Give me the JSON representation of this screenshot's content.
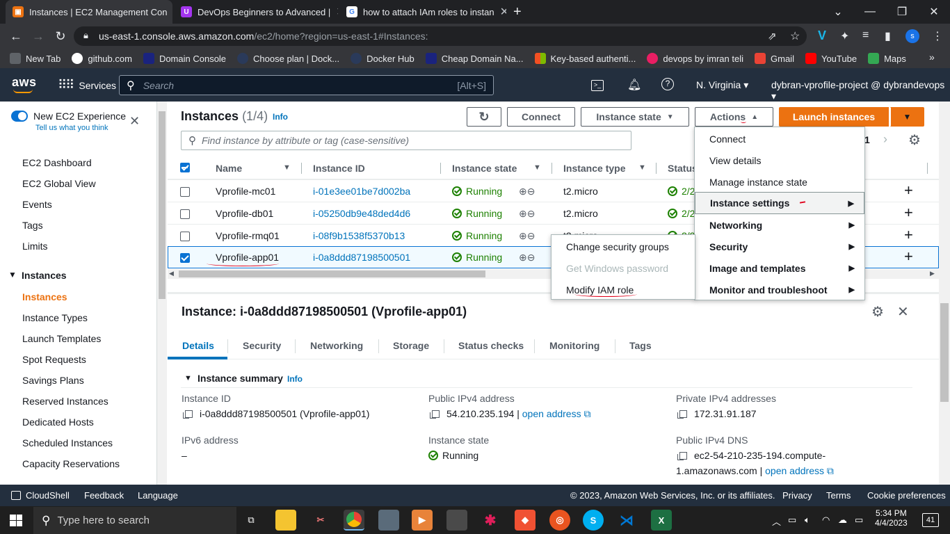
{
  "browser": {
    "tabs": [
      {
        "title": "Instances | EC2 Management Con",
        "active": true
      },
      {
        "title": "DevOps Beginners to Advanced |",
        "active": false
      },
      {
        "title": "how to attach IAm roles to instan",
        "active": false
      }
    ],
    "url_host": "us-east-1.console.aws.amazon.com",
    "url_path": "/ec2/home?region=us-east-1#Instances:",
    "bookmarks": [
      "New Tab",
      "github.com",
      "Domain Console",
      "Choose plan | Dock...",
      "Docker Hub",
      "Cheap Domain Na...",
      "Key-based authenti...",
      "devops by imran teli",
      "Gmail",
      "YouTube",
      "Maps"
    ]
  },
  "aws": {
    "logo": "aws",
    "services": "Services",
    "search_placeholder": "Search",
    "search_shortcut": "[Alt+S]",
    "region": "N. Virginia",
    "account": "dybran-vprofile-project @ dybrandevops"
  },
  "sidebar": {
    "new_experience": "New EC2 Experience",
    "tell_us": "Tell us what you think",
    "items": [
      "EC2 Dashboard",
      "EC2 Global View",
      "Events",
      "Tags",
      "Limits"
    ],
    "section": "Instances",
    "section_items": [
      "Instances",
      "Instance Types",
      "Launch Templates",
      "Spot Requests",
      "Savings Plans",
      "Reserved Instances",
      "Dedicated Hosts",
      "Scheduled Instances",
      "Capacity Reservations"
    ]
  },
  "instances": {
    "title": "Instances",
    "count": "(1/4)",
    "info": "Info",
    "connect": "Connect",
    "instance_state": "Instance state",
    "actions": "Actions",
    "launch": "Launch instances",
    "filter_placeholder": "Find instance by attribute or tag (case-sensitive)",
    "page": "1",
    "columns": [
      "Name",
      "Instance ID",
      "Instance state",
      "Instance type",
      "Status"
    ],
    "rows": [
      {
        "name": "Vprofile-mc01",
        "id": "i-01e3ee01be7d002ba",
        "state": "Running",
        "type": "t2.micro",
        "status": "2/2",
        "selected": false
      },
      {
        "name": "Vprofile-db01",
        "id": "i-05250db9e48ded4d6",
        "state": "Running",
        "type": "t2.micro",
        "status": "2/2",
        "selected": false
      },
      {
        "name": "Vprofile-rmq01",
        "id": "i-08f9b1538f5370b13",
        "state": "Running",
        "type": "t2.micro",
        "status": "2/2",
        "selected": false
      },
      {
        "name": "Vprofile-app01",
        "id": "i-0a8ddd87198500501",
        "state": "Running",
        "type": "",
        "status": "",
        "selected": true
      }
    ]
  },
  "actions_menu": {
    "items": [
      "Connect",
      "View details",
      "Manage instance state",
      "Instance settings",
      "Networking",
      "Security",
      "Image and templates",
      "Monitor and troubleshoot"
    ]
  },
  "security_submenu": {
    "items": [
      "Change security groups",
      "Get Windows password",
      "Modify IAM role"
    ]
  },
  "detail": {
    "title": "Instance: i-0a8ddd87198500501 (Vprofile-app01)",
    "tabs": [
      "Details",
      "Security",
      "Networking",
      "Storage",
      "Status checks",
      "Monitoring",
      "Tags"
    ],
    "summary": "Instance summary",
    "info": "Info",
    "instance_id_label": "Instance ID",
    "instance_id_value": "i-0a8ddd87198500501 (Vprofile-app01)",
    "public_ipv4_label": "Public IPv4 address",
    "public_ipv4_value": "54.210.235.194",
    "open_address": "open address",
    "private_ipv4_label": "Private IPv4 addresses",
    "private_ipv4_value": "172.31.91.187",
    "ipv6_label": "IPv6 address",
    "ipv6_value": "–",
    "state_label": "Instance state",
    "state_value": "Running",
    "public_dns_label": "Public IPv4 DNS",
    "public_dns_value_1": "ec2-54-210-235-194.compute-",
    "public_dns_value_2": "1.amazonaws.com"
  },
  "footer": {
    "cloudshell": "CloudShell",
    "feedback": "Feedback",
    "language": "Language",
    "copyright": "© 2023, Amazon Web Services, Inc. or its affiliates.",
    "privacy": "Privacy",
    "terms": "Terms",
    "cookies": "Cookie preferences"
  },
  "taskbar": {
    "search_placeholder": "Type here to search",
    "time": "5:34 PM",
    "date": "4/4/2023",
    "notifications": "41"
  }
}
